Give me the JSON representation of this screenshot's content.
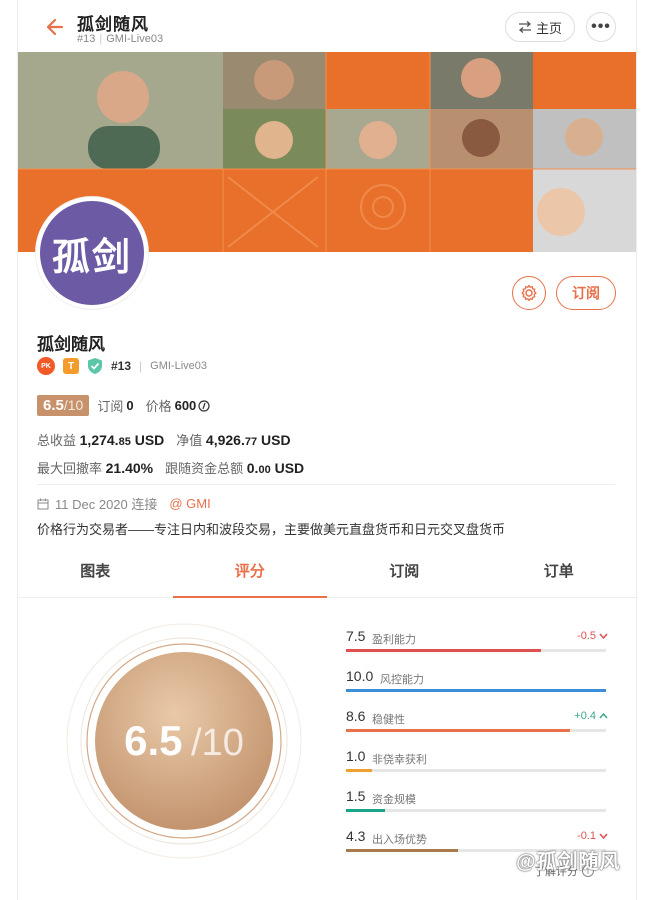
{
  "header": {
    "title": "孤剑随风",
    "rank": "#13",
    "server": "GMI-Live03",
    "home_label": "主页",
    "more_label": "•••"
  },
  "profile": {
    "avatar_text": "孤剑",
    "name": "孤剑随风",
    "badge_pk": "PK",
    "badge_t": "T",
    "rank": "#13",
    "server": "GMI-Live03",
    "subscribe_label": "订阅"
  },
  "summary": {
    "score": "6.5",
    "score_den": "/10",
    "subs_label": "订阅",
    "subs_value": "0",
    "price_label": "价格",
    "price_value": "600",
    "total_profit_label": "总收益",
    "total_profit_int": "1,274.",
    "total_profit_dec": "85",
    "total_profit_unit": "USD",
    "equity_label": "净值",
    "equity_int": "4,926.",
    "equity_dec": "77",
    "equity_unit": "USD",
    "drawdown_label": "最大回撤率",
    "drawdown_value": "21.40%",
    "follow_label": "跟随资金总额",
    "follow_int": "0.",
    "follow_dec": "00",
    "follow_unit": "USD",
    "connected": "11 Dec 2020 连接",
    "broker": "@ GMI",
    "bio": "价格行为交易者——专注日内和波段交易，主要做美元直盘货币和日元交叉盘货币"
  },
  "tabs": [
    "图表",
    "评分",
    "订阅",
    "订单"
  ],
  "active_tab": 1,
  "rating": {
    "score": "6.5",
    "den": "/10",
    "metrics": [
      {
        "value": "7.5",
        "label": "盈利能力",
        "change": "-0.5",
        "dir": "down",
        "pct": 0.75,
        "color": "#e05050"
      },
      {
        "value": "10.0",
        "label": "风控能力",
        "change": "",
        "dir": "",
        "pct": 1.0,
        "color": "#3a8fd8"
      },
      {
        "value": "8.6",
        "label": "稳健性",
        "change": "+0.4",
        "dir": "up",
        "pct": 0.86,
        "color": "#e8704a"
      },
      {
        "value": "1.0",
        "label": "非侥幸获利",
        "change": "",
        "dir": "",
        "pct": 0.1,
        "color": "#f0a030"
      },
      {
        "value": "1.5",
        "label": "资金规模",
        "change": "",
        "dir": "",
        "pct": 0.15,
        "color": "#1aa58a"
      },
      {
        "value": "4.3",
        "label": "出入场优势",
        "change": "-0.1",
        "dir": "down",
        "pct": 0.43,
        "color": "#a67a4a"
      }
    ],
    "learn_label": "了解评分",
    "learn_icon": "i"
  },
  "watermark": "@孤剑随风",
  "colors": {
    "accent": "#e8704a",
    "avatar": "#6d5aa5",
    "banner": "#e8702a"
  }
}
